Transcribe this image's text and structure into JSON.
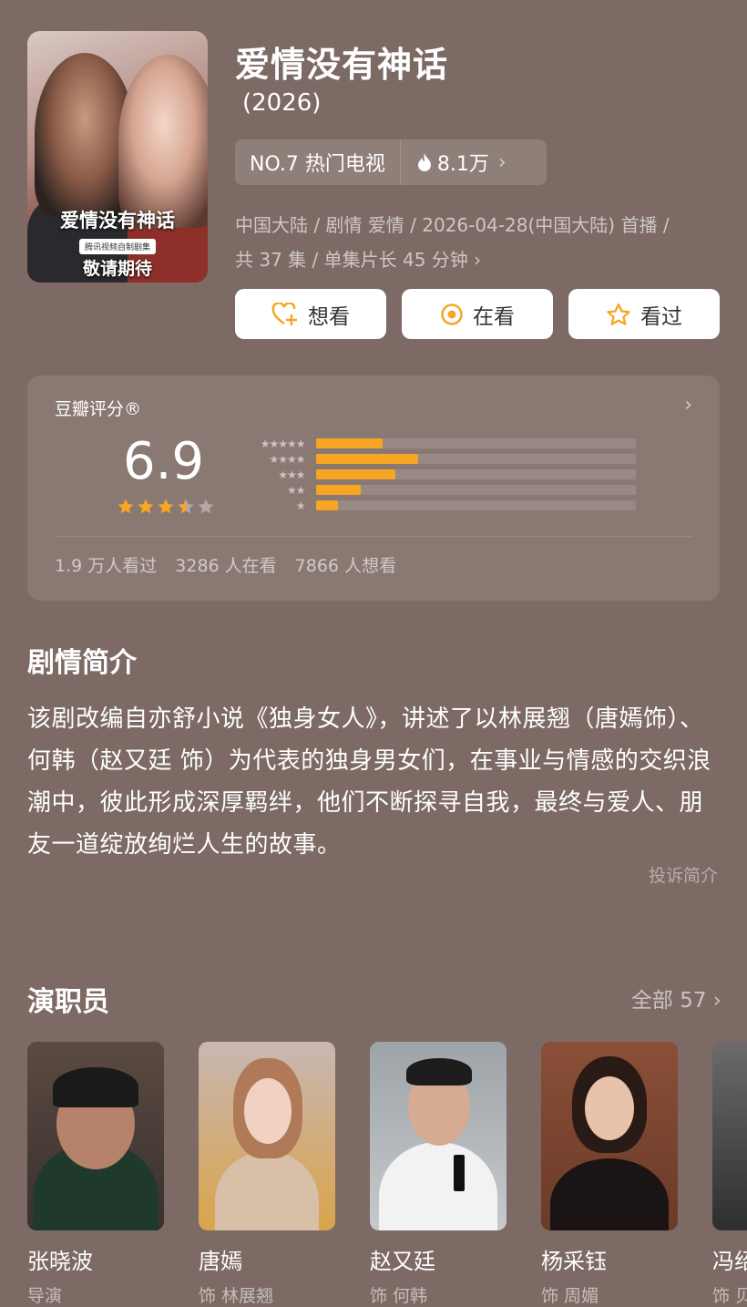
{
  "show": {
    "title": "爱情没有神话",
    "year": "(2026)",
    "poster": {
      "title": "爱情没有神话",
      "badge": "腾讯视频自制剧集",
      "subtitle": "敬请期待"
    },
    "rank": "NO.7 热门电视",
    "heat": "8.1万",
    "meta_line1": "中国大陆 / 剧情 爱情 / 2026-04-28(中国大陆) 首播 /",
    "meta_line2": "共 37 集 / 单集片长 45 分钟"
  },
  "actions": {
    "want": "想看",
    "watching": "在看",
    "watched": "看过"
  },
  "rating": {
    "label": "豆瓣评分®",
    "score": "6.9",
    "stars_value": 3.5,
    "distribution": [
      {
        "stars": "★★★★★",
        "fraction": 0.21
      },
      {
        "stars": "★★★★",
        "fraction": 0.32
      },
      {
        "stars": "★★★",
        "fraction": 0.25
      },
      {
        "stars": "★★",
        "fraction": 0.14
      },
      {
        "stars": "★",
        "fraction": 0.07
      }
    ],
    "counts": {
      "watched": "1.9 万人看过",
      "watching": "3286 人在看",
      "want": "7866 人想看"
    }
  },
  "synopsis": {
    "title": "剧情简介",
    "text": "该剧改编自亦舒小说《独身女人》，讲述了以林展翘（唐嫣饰）、何韩（赵又廷 饰）为代表的独身男女们，在事业与情感的交织浪潮中，彼此形成深厚羁绊，他们不断探寻自我，最终与爱人、朋友一道绽放绚烂人生的故事。",
    "report": "投诉简介"
  },
  "cast": {
    "title": "演职员",
    "all_label": "全部 57",
    "members": [
      {
        "name": "张晓波",
        "role": "导演"
      },
      {
        "name": "唐嫣",
        "role": "饰 林展翘"
      },
      {
        "name": "赵又廷",
        "role": "饰 何韩"
      },
      {
        "name": "杨采钰",
        "role": "饰 周媚"
      },
      {
        "name": "冯绍",
        "role": "饰 贝"
      }
    ]
  },
  "colors": {
    "accent": "#f6a623",
    "background": "#7d6a64"
  }
}
